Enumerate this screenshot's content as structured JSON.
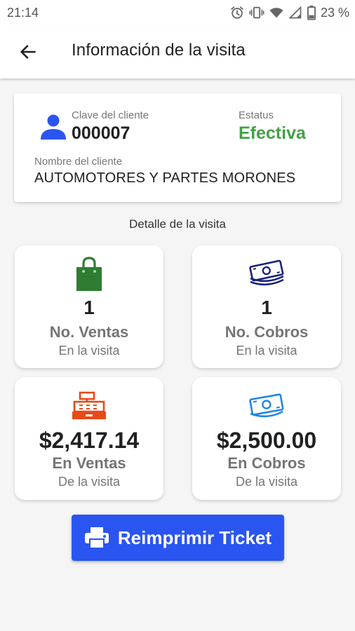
{
  "status_bar": {
    "time": "21:14",
    "battery_text": "23 %",
    "icons": [
      "alarm-icon",
      "vibrate-icon",
      "wifi-icon",
      "signal-icon",
      "battery-icon"
    ]
  },
  "app_bar": {
    "title": "Información de la visita",
    "back_icon": "arrow-back-icon"
  },
  "client": {
    "id_label": "Clave del cliente",
    "id_value": "000007",
    "status_label": "Estatus",
    "status_value": "Efectiva",
    "name_label": "Nombre del cliente",
    "name_value": "AUTOMOTORES Y PARTES MORONES",
    "icon": "person-icon"
  },
  "detail": {
    "title": "Detalle de la visita",
    "cards": [
      {
        "icon": "shopping-bag-icon",
        "value": "1",
        "title": "No. Ventas",
        "subtitle": "En la visita"
      },
      {
        "icon": "money-stack-icon",
        "value": "1",
        "title": "No. Cobros",
        "subtitle": "En la visita"
      },
      {
        "icon": "cash-register-icon",
        "value": "$2,417.14",
        "title": "En Ventas",
        "subtitle": "De la visita"
      },
      {
        "icon": "banknote-icon",
        "value": "$2,500.00",
        "title": "En Cobros",
        "subtitle": "De la visita"
      }
    ]
  },
  "reprint_button": {
    "label": "Reimprimir Ticket",
    "icon": "printer-icon"
  },
  "colors": {
    "accent_blue": "#2b55f0",
    "status_green": "#43a047",
    "bag_green": "#2e7d32",
    "money_navy": "#1a237e",
    "register_orange": "#e64a19",
    "bill_blue": "#1e88e5"
  }
}
